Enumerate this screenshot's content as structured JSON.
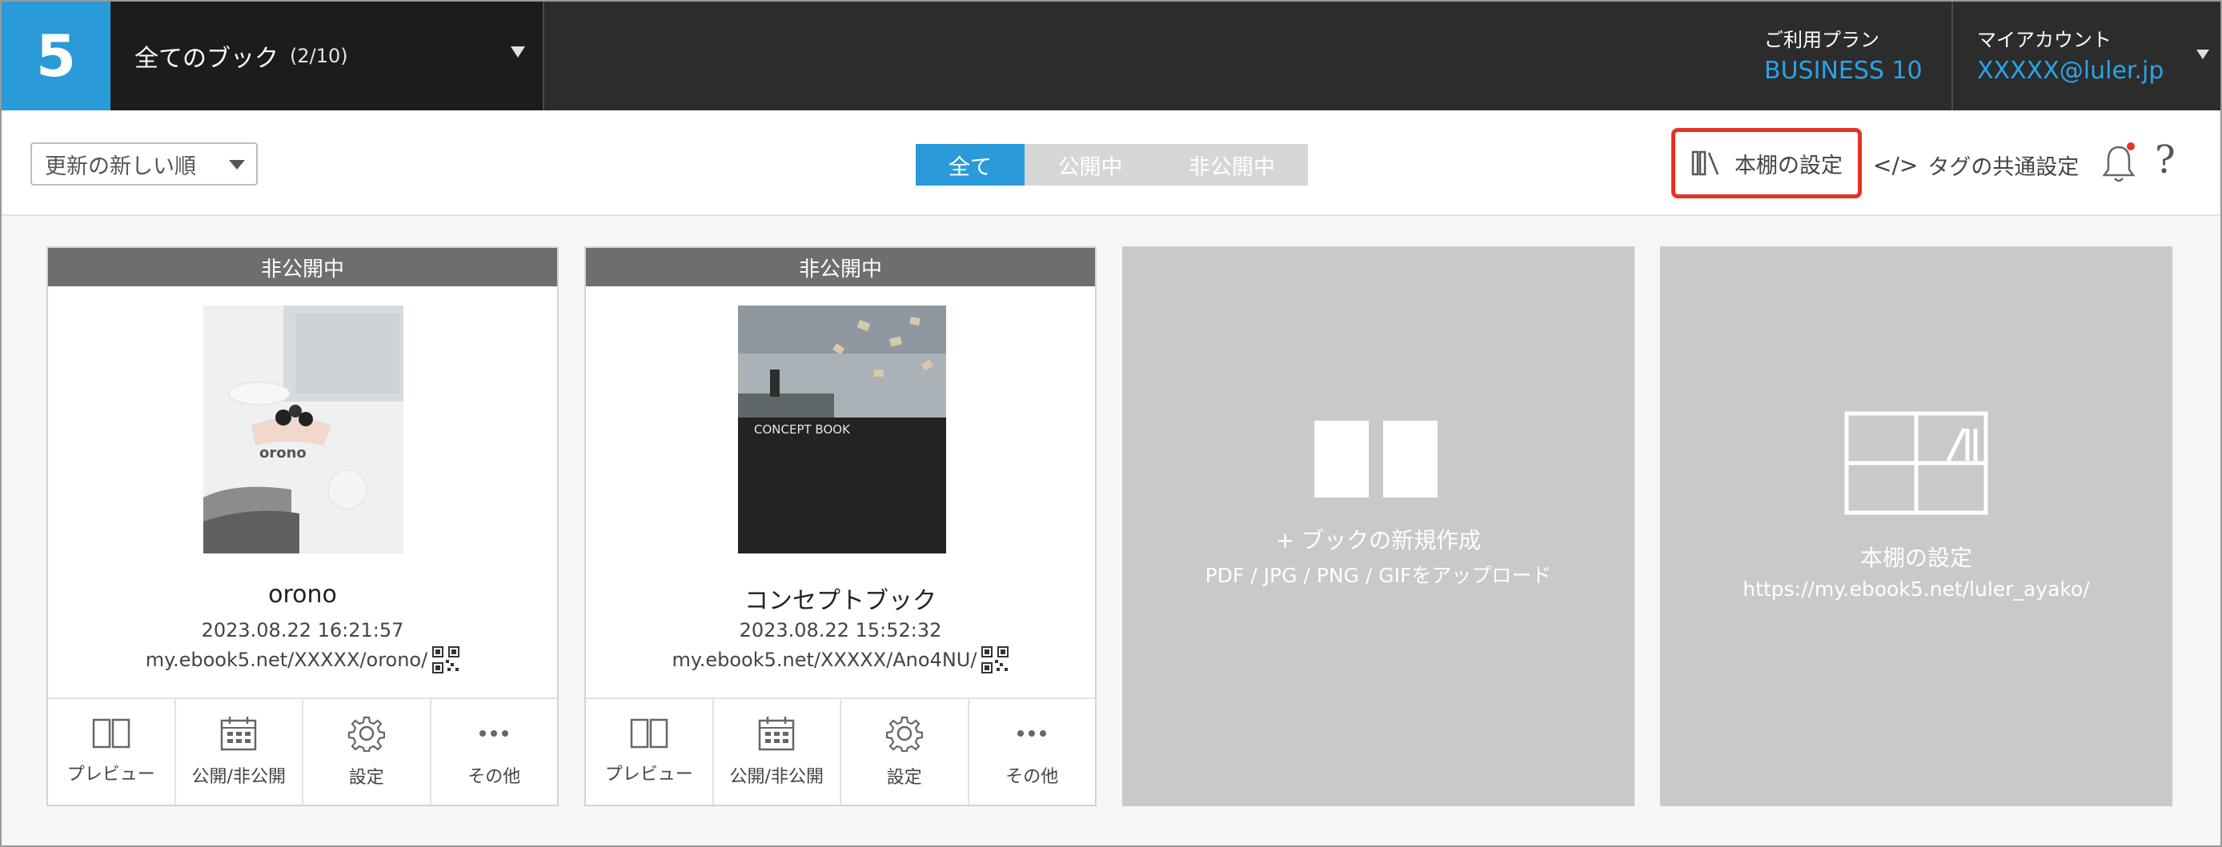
{
  "header": {
    "logo": "5",
    "book_select": {
      "title": "全てのブック",
      "count": "(2/10)"
    },
    "plan": {
      "label": "ご利用プラン",
      "value": "BUSINESS 10"
    },
    "account": {
      "label": "マイアカウント",
      "value": "XXXXX@luler.jp"
    }
  },
  "toolbar": {
    "sort_value": "更新の新しい順",
    "tabs": [
      {
        "label": "全て",
        "active": true
      },
      {
        "label": "公開中",
        "active": false
      },
      {
        "label": "非公開中",
        "active": false
      }
    ],
    "shelf_settings": "本棚の設定",
    "tag_settings_code": "</>",
    "tag_settings": "タグの共通設定",
    "help": "?"
  },
  "books": [
    {
      "status": "非公開中",
      "name": "orono",
      "date": "2023.08.22 16:21:57",
      "url": "my.ebook5.net/XXXXX/orono/",
      "cover_text": "orono"
    },
    {
      "status": "非公開中",
      "name": "コンセプトブック",
      "date": "2023.08.22 15:52:32",
      "url": "my.ebook5.net/XXXXX/Ano4NU/",
      "cover_text": "CONCEPT BOOK"
    }
  ],
  "actions": {
    "preview": "プレビュー",
    "publish": "公開/非公開",
    "settings": "設定",
    "other": "その他"
  },
  "new_book": {
    "title": "+ ブックの新規作成",
    "subtitle": "PDF / JPG / PNG / GIFをアップロード"
  },
  "shelf_panel": {
    "title": "本棚の設定",
    "url": "https://my.ebook5.net/luler_ayako/"
  },
  "colors": {
    "accent": "#2a9bd8",
    "header_bg": "#2c2c2c",
    "highlight": "#e43224",
    "status_bg": "#6e6e6e"
  }
}
